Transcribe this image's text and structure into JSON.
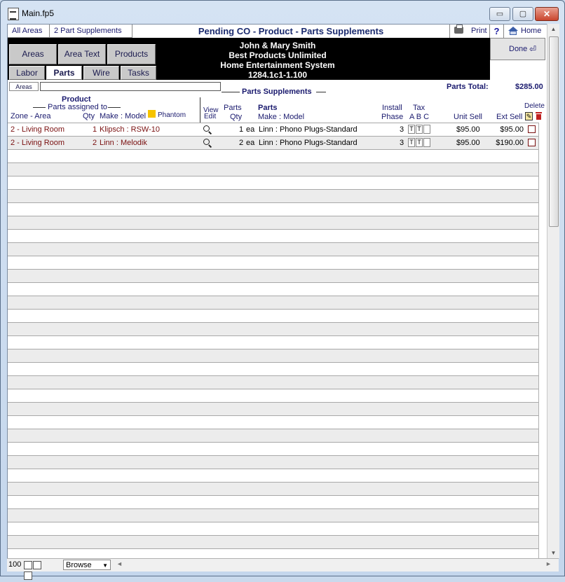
{
  "window": {
    "title": "Main.fp5",
    "min_glyph": "▭",
    "max_glyph": "▢",
    "close_glyph": "✕"
  },
  "header": {
    "tab_all_areas": "All Areas",
    "tab_part_supplements": "2  Part Supplements",
    "title": "Pending CO - Product - Parts Supplements",
    "print_label": "Print",
    "help_label": "?",
    "home_label": "Home",
    "done_label": "Done",
    "done_arrow": "⏎"
  },
  "nav": {
    "areas": "Areas",
    "area_text": "Area Text",
    "products": "Products",
    "labor": "Labor",
    "parts": "Parts",
    "wire": "Wire",
    "tasks": "Tasks"
  },
  "client": {
    "name": "John & Mary Smith",
    "company": "Best Products Unlimited",
    "system": "Home Entertainment System",
    "id": "1284.1c1-1.100"
  },
  "filter": {
    "areas_label": "Areas",
    "areas_value": ""
  },
  "section": {
    "title": "Parts Supplements",
    "parts_total_label": "Parts Total:",
    "parts_total_value": "$285.00"
  },
  "columns": {
    "product": "Product",
    "parts_assigned_to": "Parts assigned to",
    "zone_area": "Zone - Area",
    "qty": "Qty",
    "make_model": "Make : Model",
    "phantom": "Phantom",
    "view": "View",
    "edit": "Edit",
    "parts": "Parts",
    "parts_qty": "Qty",
    "parts_bold": "Parts",
    "parts_make_model": "Make : Model",
    "install": "Install",
    "phase": "Phase",
    "tax": "Tax",
    "tax_abc": "A B C",
    "unit_sell": "Unit Sell",
    "ext_sell": "Ext Sell",
    "delete": "Delete"
  },
  "rows": [
    {
      "zone_area": "2 - Living Room",
      "qty": "1",
      "make_model": "Klipsch : RSW-10",
      "parts_qty": "1",
      "unit": "ea",
      "parts_make_model": "Linn : Phono Plugs-Standard",
      "phase": "3",
      "tax_a": "T",
      "tax_b": "T",
      "tax_c": "",
      "unit_sell": "$95.00",
      "ext_sell": "$95.00"
    },
    {
      "zone_area": "2 - Living Room",
      "qty": "2",
      "make_model": "Linn : Melodik",
      "parts_qty": "2",
      "unit": "ea",
      "parts_make_model": "Linn : Phono Plugs-Standard",
      "phase": "3",
      "tax_a": "T",
      "tax_b": "T",
      "tax_c": "",
      "unit_sell": "$95.00",
      "ext_sell": "$190.00"
    }
  ],
  "statusbar": {
    "zoom": "100",
    "mode": "Browse",
    "mode_arrow": "▼",
    "scroll_left": "◄",
    "scroll_right": "►"
  },
  "scrollbar": {
    "up": "▲",
    "down": "▼"
  }
}
